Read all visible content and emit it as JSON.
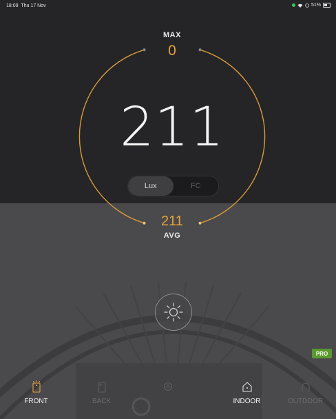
{
  "status_bar": {
    "time": "18:09",
    "date": "Thu 17 Nov",
    "battery": "51%"
  },
  "meter": {
    "max_label": "MAX",
    "max_value": "0",
    "reading": "211",
    "units": [
      "Lux",
      "FC"
    ],
    "active_unit": "Lux",
    "avg_value": "211",
    "avg_label": "AVG"
  },
  "pro_badge": "PRO",
  "tabs": [
    {
      "label": "FRONT",
      "icon": "front-camera-icon",
      "active": true
    },
    {
      "label": "BACK",
      "icon": "back-camera-icon",
      "active": false
    },
    {
      "label": "",
      "icon": "settings-icon",
      "active": false
    },
    {
      "label": "INDOOR",
      "icon": "indoor-house-icon",
      "active": true
    },
    {
      "label": "OUTDOOR",
      "icon": "outdoor-icon",
      "active": false
    }
  ],
  "colors": {
    "accent": "#e8a23a",
    "pro": "#5a9a2e",
    "top_bg": "#252527",
    "bottom_bg": "#4a4a4c"
  }
}
